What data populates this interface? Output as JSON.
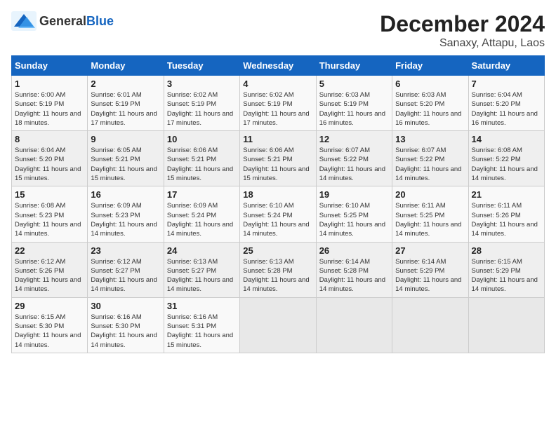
{
  "header": {
    "logo_general": "General",
    "logo_blue": "Blue",
    "month_title": "December 2024",
    "location": "Sanaxy, Attapu, Laos"
  },
  "weekdays": [
    "Sunday",
    "Monday",
    "Tuesday",
    "Wednesday",
    "Thursday",
    "Friday",
    "Saturday"
  ],
  "weeks": [
    [
      {
        "day": "1",
        "sunrise": "6:00 AM",
        "sunset": "5:19 PM",
        "daylight": "11 hours and 18 minutes."
      },
      {
        "day": "2",
        "sunrise": "6:01 AM",
        "sunset": "5:19 PM",
        "daylight": "11 hours and 17 minutes."
      },
      {
        "day": "3",
        "sunrise": "6:02 AM",
        "sunset": "5:19 PM",
        "daylight": "11 hours and 17 minutes."
      },
      {
        "day": "4",
        "sunrise": "6:02 AM",
        "sunset": "5:19 PM",
        "daylight": "11 hours and 17 minutes."
      },
      {
        "day": "5",
        "sunrise": "6:03 AM",
        "sunset": "5:19 PM",
        "daylight": "11 hours and 16 minutes."
      },
      {
        "day": "6",
        "sunrise": "6:03 AM",
        "sunset": "5:20 PM",
        "daylight": "11 hours and 16 minutes."
      },
      {
        "day": "7",
        "sunrise": "6:04 AM",
        "sunset": "5:20 PM",
        "daylight": "11 hours and 16 minutes."
      }
    ],
    [
      {
        "day": "8",
        "sunrise": "6:04 AM",
        "sunset": "5:20 PM",
        "daylight": "11 hours and 15 minutes."
      },
      {
        "day": "9",
        "sunrise": "6:05 AM",
        "sunset": "5:21 PM",
        "daylight": "11 hours and 15 minutes."
      },
      {
        "day": "10",
        "sunrise": "6:06 AM",
        "sunset": "5:21 PM",
        "daylight": "11 hours and 15 minutes."
      },
      {
        "day": "11",
        "sunrise": "6:06 AM",
        "sunset": "5:21 PM",
        "daylight": "11 hours and 15 minutes."
      },
      {
        "day": "12",
        "sunrise": "6:07 AM",
        "sunset": "5:22 PM",
        "daylight": "11 hours and 14 minutes."
      },
      {
        "day": "13",
        "sunrise": "6:07 AM",
        "sunset": "5:22 PM",
        "daylight": "11 hours and 14 minutes."
      },
      {
        "day": "14",
        "sunrise": "6:08 AM",
        "sunset": "5:22 PM",
        "daylight": "11 hours and 14 minutes."
      }
    ],
    [
      {
        "day": "15",
        "sunrise": "6:08 AM",
        "sunset": "5:23 PM",
        "daylight": "11 hours and 14 minutes."
      },
      {
        "day": "16",
        "sunrise": "6:09 AM",
        "sunset": "5:23 PM",
        "daylight": "11 hours and 14 minutes."
      },
      {
        "day": "17",
        "sunrise": "6:09 AM",
        "sunset": "5:24 PM",
        "daylight": "11 hours and 14 minutes."
      },
      {
        "day": "18",
        "sunrise": "6:10 AM",
        "sunset": "5:24 PM",
        "daylight": "11 hours and 14 minutes."
      },
      {
        "day": "19",
        "sunrise": "6:10 AM",
        "sunset": "5:25 PM",
        "daylight": "11 hours and 14 minutes."
      },
      {
        "day": "20",
        "sunrise": "6:11 AM",
        "sunset": "5:25 PM",
        "daylight": "11 hours and 14 minutes."
      },
      {
        "day": "21",
        "sunrise": "6:11 AM",
        "sunset": "5:26 PM",
        "daylight": "11 hours and 14 minutes."
      }
    ],
    [
      {
        "day": "22",
        "sunrise": "6:12 AM",
        "sunset": "5:26 PM",
        "daylight": "11 hours and 14 minutes."
      },
      {
        "day": "23",
        "sunrise": "6:12 AM",
        "sunset": "5:27 PM",
        "daylight": "11 hours and 14 minutes."
      },
      {
        "day": "24",
        "sunrise": "6:13 AM",
        "sunset": "5:27 PM",
        "daylight": "11 hours and 14 minutes."
      },
      {
        "day": "25",
        "sunrise": "6:13 AM",
        "sunset": "5:28 PM",
        "daylight": "11 hours and 14 minutes."
      },
      {
        "day": "26",
        "sunrise": "6:14 AM",
        "sunset": "5:28 PM",
        "daylight": "11 hours and 14 minutes."
      },
      {
        "day": "27",
        "sunrise": "6:14 AM",
        "sunset": "5:29 PM",
        "daylight": "11 hours and 14 minutes."
      },
      {
        "day": "28",
        "sunrise": "6:15 AM",
        "sunset": "5:29 PM",
        "daylight": "11 hours and 14 minutes."
      }
    ],
    [
      {
        "day": "29",
        "sunrise": "6:15 AM",
        "sunset": "5:30 PM",
        "daylight": "11 hours and 14 minutes."
      },
      {
        "day": "30",
        "sunrise": "6:16 AM",
        "sunset": "5:30 PM",
        "daylight": "11 hours and 14 minutes."
      },
      {
        "day": "31",
        "sunrise": "6:16 AM",
        "sunset": "5:31 PM",
        "daylight": "11 hours and 15 minutes."
      },
      null,
      null,
      null,
      null
    ]
  ]
}
